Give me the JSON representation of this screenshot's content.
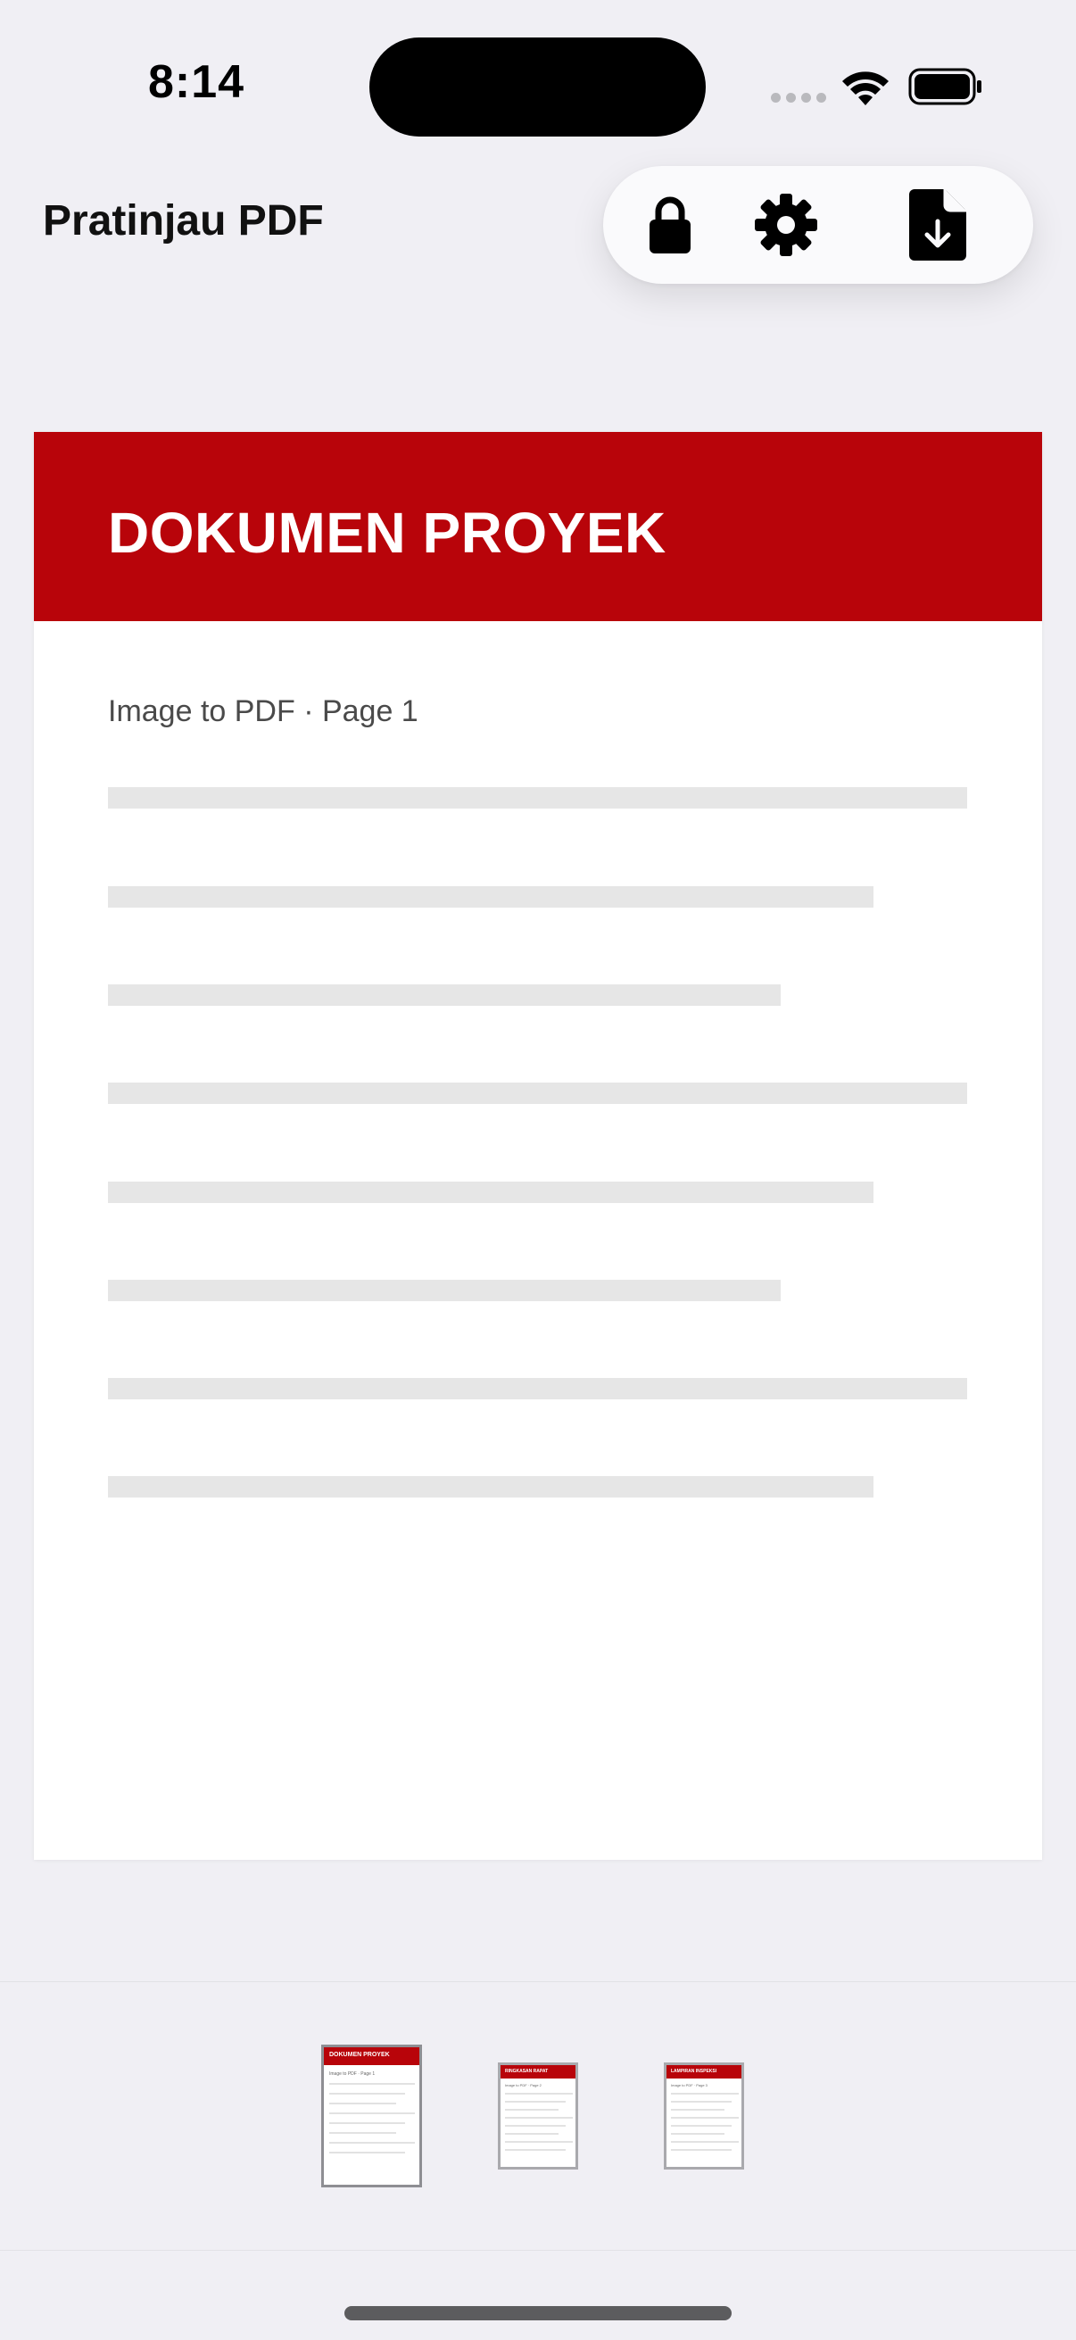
{
  "status_bar": {
    "time": "8:14"
  },
  "nav": {
    "title": "Pratinjau PDF"
  },
  "toolbar": {
    "lock_icon": "lock-icon",
    "settings_icon": "gear-icon",
    "export_icon": "document-download-icon"
  },
  "page": {
    "title": "DOKUMEN PROYEK",
    "subtitle": "Image to PDF · Page 1",
    "accent_color": "#b8040a"
  },
  "thumbnails": [
    {
      "title": "DOKUMEN PROYEK",
      "subtitle": "Image to PDF · Page 1",
      "selected": true
    },
    {
      "title": "RINGKASAN RAPAT",
      "subtitle": "Image to PDF · Page 2",
      "selected": false
    },
    {
      "title": "LAMPIRAN INSPEKSI",
      "subtitle": "Image to PDF · Page 3",
      "selected": false
    }
  ]
}
